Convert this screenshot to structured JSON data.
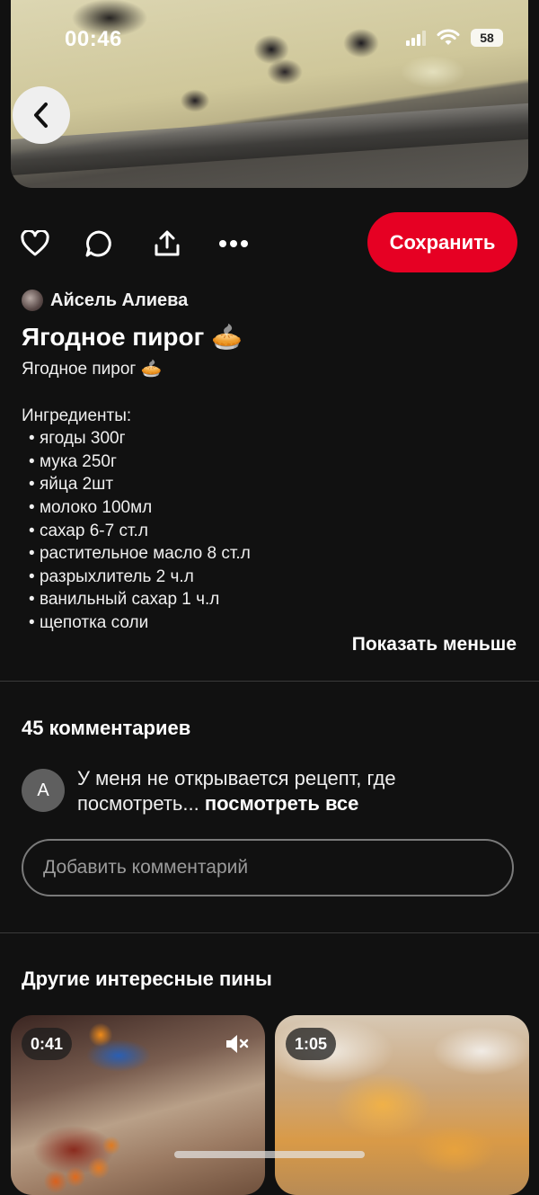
{
  "status_bar": {
    "time": "00:46",
    "battery": "58"
  },
  "actions": {
    "save_label": "Сохранить"
  },
  "pin": {
    "author": "Айсель Алиева",
    "title": "Ягодное пирог 🥧",
    "subtitle": "Ягодное пирог 🥧",
    "ingredients_title": "Ингредиенты:",
    "ingredients": [
      "ягоды 300г",
      "мука 250г",
      "яйца 2шт",
      "молоко 100мл",
      "сахар 6-7 ст.л",
      "растительное масло 8 ст.л",
      "разрыхлитель 2 ч.л",
      "ванильный сахар 1 ч.л",
      "щепотка соли"
    ],
    "show_less": "Показать меньше"
  },
  "comments": {
    "title": "45 комментариев",
    "first": {
      "avatar_letter": "A",
      "text": "У меня не открывается рецепт, где посмотреть...",
      "see_all": "посмотреть все"
    },
    "input_placeholder": "Добавить комментарий"
  },
  "more_pins": {
    "title": "Другие интересные пины",
    "cards": [
      {
        "duration": "0:41",
        "muted": true
      },
      {
        "duration": "1:05",
        "muted": false
      }
    ]
  },
  "colors": {
    "save": "#e60023",
    "background": "#111111"
  }
}
